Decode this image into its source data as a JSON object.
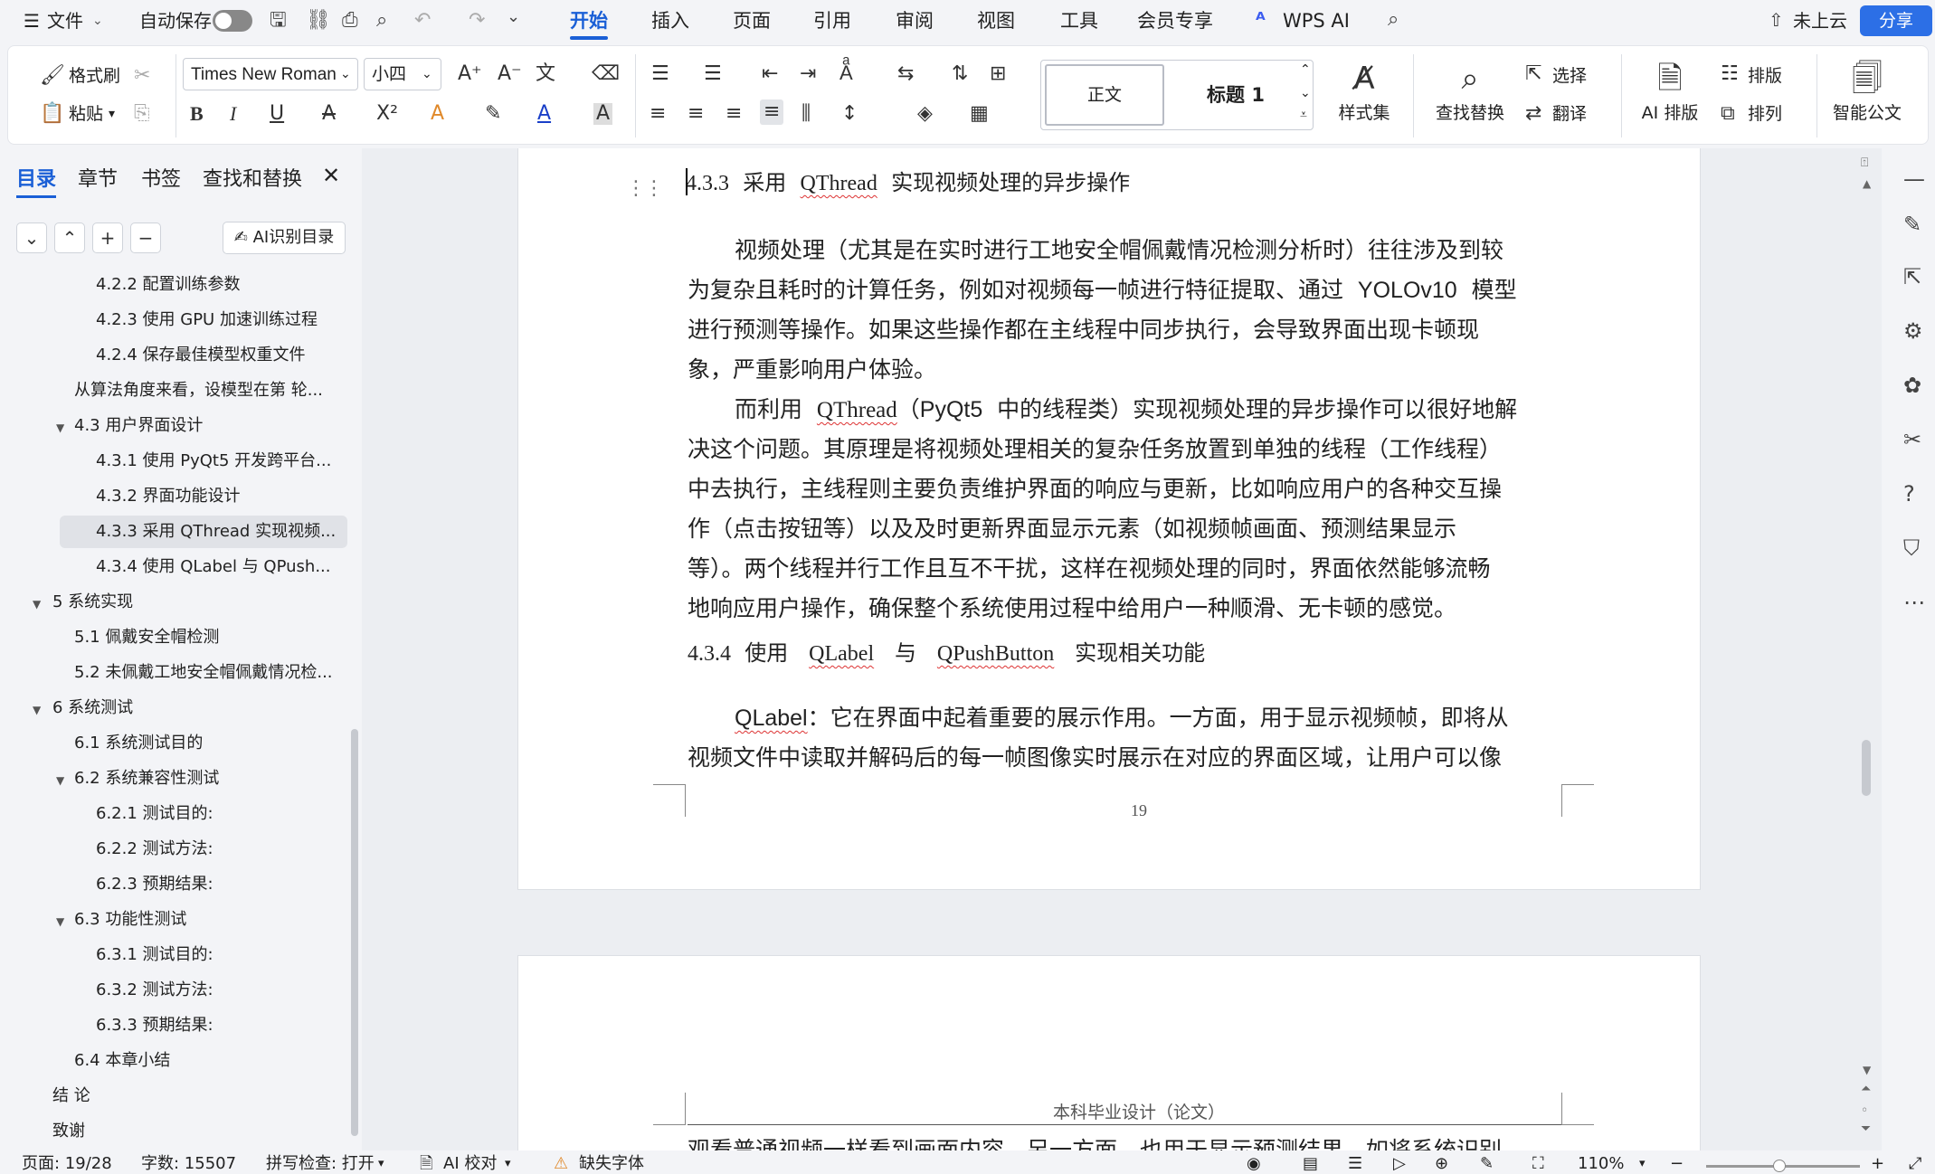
{
  "menubar": {
    "menu_label": "文件",
    "autosave_label": "自动保存",
    "tabs": [
      "开始",
      "插入",
      "页面",
      "引用",
      "审阅",
      "视图",
      "工具",
      "会员专享",
      "WPS AI"
    ],
    "cloud_label": "未上云",
    "share_label": "分享"
  },
  "ribbon": {
    "format_painter": "格式刷",
    "paste": "粘贴",
    "font_name": "Times New Roman",
    "font_size": "小四",
    "style_normal": "正文",
    "style_heading1": "标题 1",
    "style_set": "样式集",
    "find_replace": "查找替换",
    "select": "选择",
    "translate": "翻译",
    "ai_layout": "AI 排版",
    "layout": "排版",
    "arrange": "排列",
    "smart_doc": "智能公文"
  },
  "left_panel": {
    "tabs": [
      "目录",
      "章节",
      "书签",
      "查找和替换"
    ],
    "ai_toc_label": "AI识别目录",
    "toc_items": [
      {
        "label": "4.2.2  配置训练参数",
        "level": 3
      },
      {
        "label": "4.2.3  使用 GPU 加速训练过程",
        "level": 3
      },
      {
        "label": "4.2.4  保存最佳模型权重文件",
        "level": 3
      },
      {
        "label": "从算法角度来看，设模型在第 轮...",
        "level": 2
      },
      {
        "label": "4.3 用户界面设计",
        "level": 2,
        "expandable": true
      },
      {
        "label": "4.3.1  使用 PyQt5 开发跨平台...",
        "level": 3
      },
      {
        "label": "4.3.2  界面功能设计",
        "level": 3
      },
      {
        "label": "4.3.3  采用 QThread 实现视频...",
        "level": 3,
        "selected": true
      },
      {
        "label": "4.3.4  使用 QLabel 与 QPush...",
        "level": 3
      },
      {
        "label": "5 系统实现",
        "level": 1,
        "expandable": true
      },
      {
        "label": "5.1 佩戴安全帽检测",
        "level": 2
      },
      {
        "label": "5.2  未佩戴工地安全帽佩戴情况检...",
        "level": 2
      },
      {
        "label": "6  系统测试",
        "level": 1,
        "expandable": true
      },
      {
        "label": "6.1  系统测试目的",
        "level": 2
      },
      {
        "label": "6.2  系统兼容性测试",
        "level": 2,
        "expandable": true
      },
      {
        "label": "6.2.1 测试目的:",
        "level": 3
      },
      {
        "label": "6.2.2 测试方法:",
        "level": 3
      },
      {
        "label": "6.2.3 预期结果:",
        "level": 3
      },
      {
        "label": "6.3  功能性测试",
        "level": 2,
        "expandable": true
      },
      {
        "label": "6.3.1 测试目的:",
        "level": 3
      },
      {
        "label": "6.3.2 测试方法:",
        "level": 3
      },
      {
        "label": "6.3.3 预期结果:",
        "level": 3
      },
      {
        "label": "6.4  本章小结",
        "level": 2
      },
      {
        "label": "结   论",
        "level": 1
      },
      {
        "label": "致谢",
        "level": 1
      }
    ]
  },
  "document": {
    "heading_433": {
      "num": "4.3.3",
      "pre": "采用",
      "kw": "QThread",
      "post": "实现视频处理的异步操作"
    },
    "p1_lines": [
      "视频处理（尤其是在实时进行工地安全帽佩戴情况检测分析时）往往涉及到较",
      "为复杂且耗时的计算任务，例如对视频每一帧进行特征提取、通过",
      "进行预测等操作。如果这些操作都在主线程中同步执行，会导致界面出现卡顿现",
      "象，严重影响用户体验。"
    ],
    "p1_kw": "YOLOv10",
    "p1_kw_after": "模型",
    "p2_first": {
      "pre": "而利用",
      "kw1": "QThread",
      "mid": "（",
      "kw2": "PyQt5",
      "post": "中的线程类）实现视频处理的异步操作可以很好地解"
    },
    "p2_lines": [
      "决这个问题。其原理是将视频处理相关的复杂任务放置到单独的线程（工作线程）",
      "中去执行，主线程则主要负责维护界面的响应与更新，比如响应用户的各种交互操",
      "作（点击按钮等）以及及时更新界面显示元素（如视频帧画面、预测结果显示",
      "等）。两个线程并行工作且互不干扰，这样在视频处理的同时，界面依然能够流畅",
      "地响应用户操作，确保整个系统使用过程中给用户一种顺滑、无卡顿的感觉。"
    ],
    "heading_434": {
      "num": "4.3.4",
      "pre": "使用",
      "kw1": "QLabel",
      "mid": "与",
      "kw2": "QPushButton",
      "post": "实现相关功能"
    },
    "p3_kw": "QLabel",
    "p3_first": "：它在界面中起着重要的展示作用。一方面，用于显示视频帧，即将从",
    "p3_second": "视频文件中读取并解码后的每一帧图像实时展示在对应的界面区域，让用户可以像",
    "page_number": "19",
    "next_header": "本科毕业设计（论文）",
    "next_partial": "观看普通视频一样看到画面内容，另一方面，也用于显示预测结果，如将系统识别"
  },
  "statusbar": {
    "page": "页面: 19/28",
    "words": "字数: 15507",
    "spell": "拼写检查: 打开",
    "ai_check": "AI 校对",
    "missing_font": "缺失字体",
    "zoom": "110%"
  }
}
